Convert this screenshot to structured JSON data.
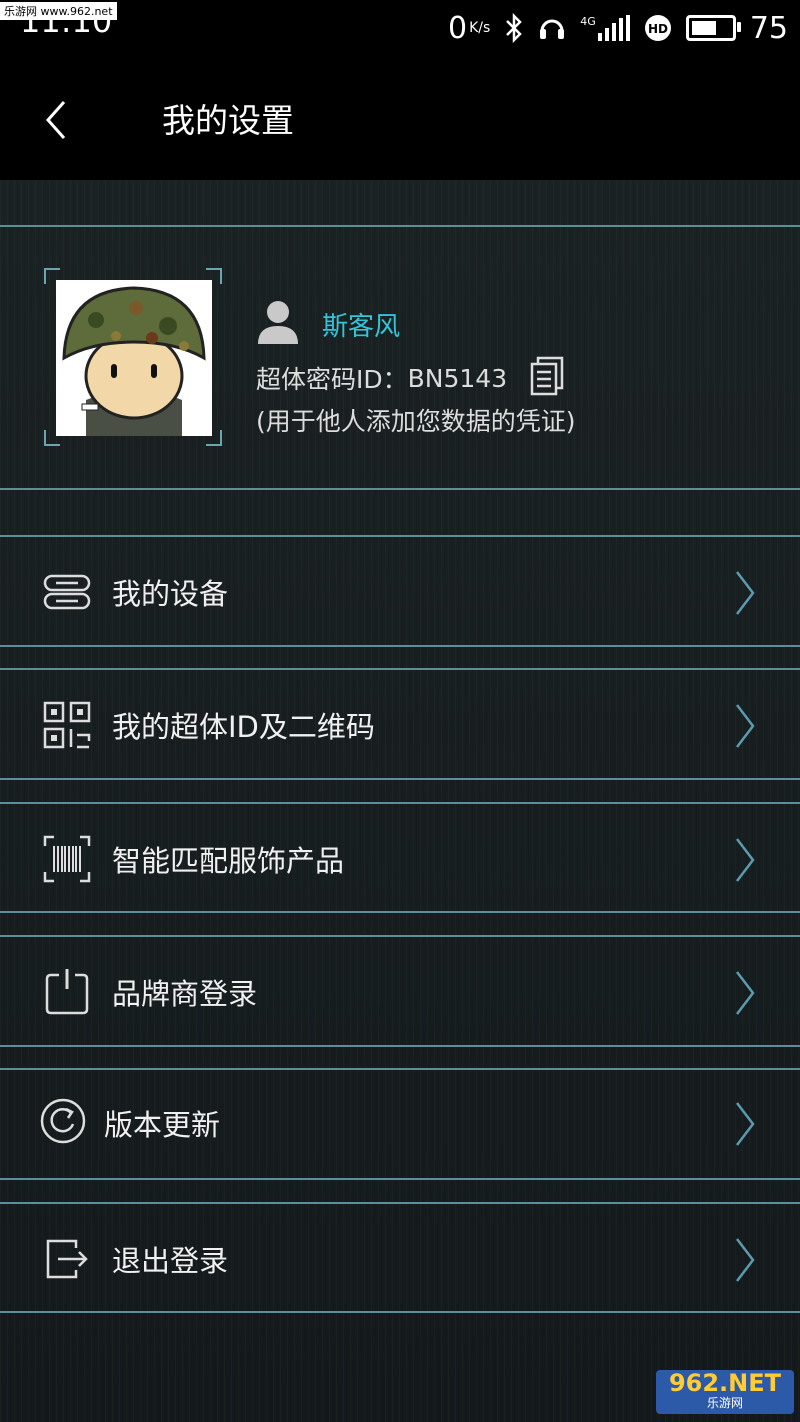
{
  "status_bar": {
    "time": "11:10",
    "net_speed": "0",
    "net_unit": "K/s",
    "network_type": "4G",
    "battery_level": "75",
    "battery_fraction": 0.75,
    "watermark_top": "乐游网 www.962.net"
  },
  "header": {
    "back_icon": "chevron-left-icon",
    "title": "我的设置"
  },
  "profile": {
    "username": "斯客风",
    "id_label": "超体密码ID：",
    "id_value": "BN5143",
    "note": "(用于他人添加您数据的凭证)"
  },
  "menu": {
    "items": [
      {
        "label": "我的设备",
        "icon": "device-icon"
      },
      {
        "label": "我的超体ID及二维码",
        "icon": "qr-code-icon"
      },
      {
        "label": "智能匹配服饰产品",
        "icon": "barcode-scan-icon"
      },
      {
        "label": "品牌商登录",
        "icon": "power-login-icon"
      },
      {
        "label": "版本更新",
        "icon": "update-icon"
      },
      {
        "label": "退出登录",
        "icon": "logout-icon"
      }
    ]
  },
  "watermark_bottom": {
    "brand": "962.NET",
    "sub": "乐游网"
  },
  "colors": {
    "accent": "#35c3d6",
    "divider": "#5e8e99",
    "arrow": "#5b9bb0",
    "header_bg": "#000000"
  }
}
